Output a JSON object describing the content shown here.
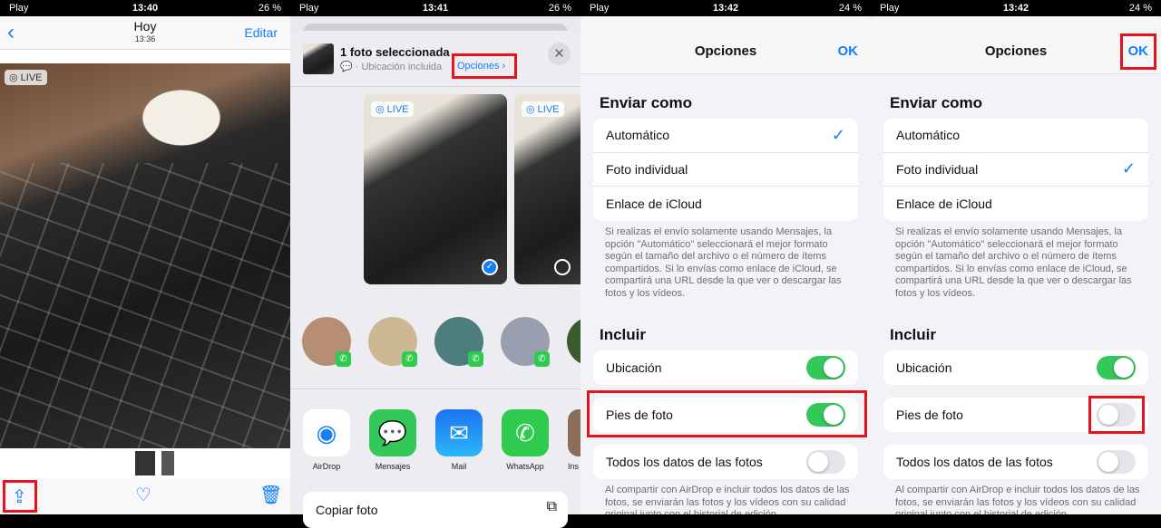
{
  "colors": {
    "accent": "#147efb",
    "toggle_on": "#34c759",
    "highlight": "#e3141c"
  },
  "panel1": {
    "status": {
      "carrier": "Play",
      "time": "13:40",
      "battery": "26 %"
    },
    "nav": {
      "title": "Hoy",
      "subtitle": "13:36",
      "edit": "Editar"
    },
    "live_badge": "LIVE",
    "icons": [
      "chevron-left",
      "share",
      "heart",
      "trash"
    ]
  },
  "panel2": {
    "status": {
      "carrier": "Play",
      "time": "13:41",
      "battery": "26 %"
    },
    "header": {
      "title": "1 foto seleccionada",
      "subtitle": "· Ubicación incluida",
      "options": "Opciones"
    },
    "photos": [
      {
        "badge": "LIVE",
        "selected": true
      },
      {
        "badge": "LIVE",
        "selected": false
      }
    ],
    "apps": [
      "AirDrop",
      "Mensajes",
      "Mail",
      "WhatsApp",
      "Ins"
    ],
    "action": "Copiar foto"
  },
  "options": {
    "title": "Opciones",
    "ok": "OK",
    "send_as_heading": "Enviar como",
    "send_as": [
      "Automático",
      "Foto individual",
      "Enlace de iCloud"
    ],
    "send_note": "Si realizas el envío solamente usando Mensajes, la opción \"Automático\" seleccionará el mejor formato según el tamaño del archivo o el número de ítems compartidos. Si lo envías como enlace de iCloud, se compartirá una URL desde la que ver o descargar las fotos y los vídeos.",
    "include_heading": "Incluir",
    "include": [
      "Ubicación",
      "Pies de foto",
      "Todos los datos de las fotos"
    ],
    "include_note": "Al compartir con AirDrop e incluir todos los datos de las fotos, se enviarán las fotos y los vídeos con su calidad original junto con el historial de edición."
  },
  "panel3": {
    "status": {
      "carrier": "Play",
      "time": "13:42",
      "battery": "24 %"
    },
    "selected": "Automático",
    "toggles": [
      true,
      true,
      false
    ]
  },
  "panel4": {
    "status": {
      "carrier": "Play",
      "time": "13:42",
      "battery": "24 %"
    },
    "selected": "Foto individual",
    "toggles": [
      true,
      false,
      false
    ]
  }
}
